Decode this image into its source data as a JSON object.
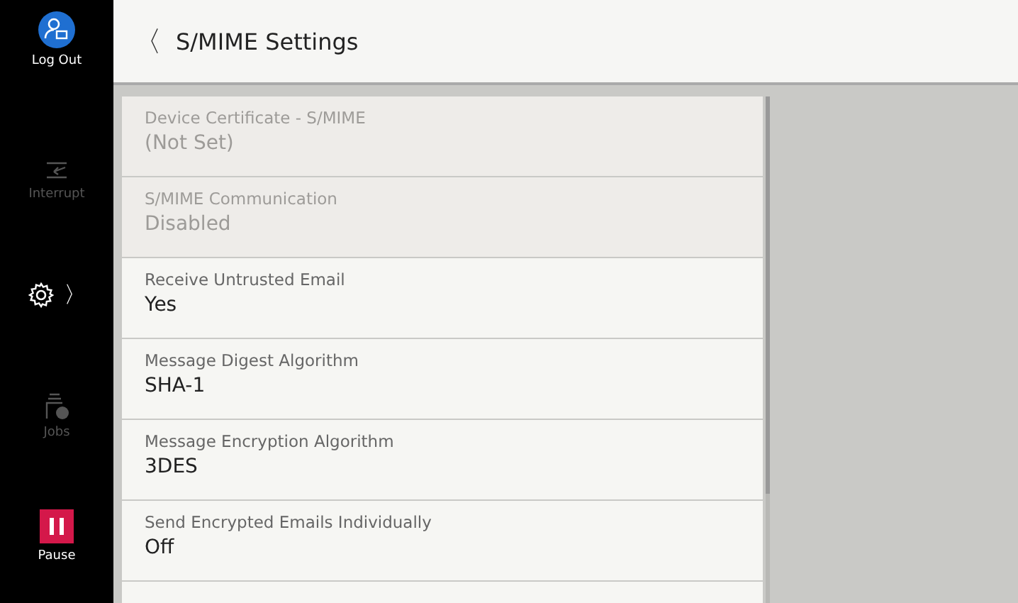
{
  "sidebar": {
    "items": [
      {
        "kind": "logout",
        "label": "Log Out",
        "disabled": false
      },
      {
        "kind": "interrupt",
        "label": "Interrupt",
        "disabled": true
      },
      {
        "kind": "settings",
        "disabled": false,
        "chevron": "〉"
      },
      {
        "kind": "jobs",
        "label": "Jobs",
        "disabled": true
      },
      {
        "kind": "pause",
        "label": "Pause",
        "disabled": false
      }
    ]
  },
  "header": {
    "back": "〈",
    "title": "S/MIME Settings"
  },
  "settings": [
    {
      "label": "Device Certificate - S/MIME",
      "value": "(Not Set)",
      "disabled": true
    },
    {
      "label": "S/MIME Communication",
      "value": "Disabled",
      "disabled": true
    },
    {
      "label": "Receive Untrusted Email",
      "value": "Yes",
      "disabled": false
    },
    {
      "label": "Message Digest Algorithm",
      "value": "SHA-1",
      "disabled": false
    },
    {
      "label": "Message Encryption Algorithm",
      "value": "3DES",
      "disabled": false
    },
    {
      "label": "Send Encrypted Emails Individually",
      "value": "Off",
      "disabled": false
    }
  ]
}
